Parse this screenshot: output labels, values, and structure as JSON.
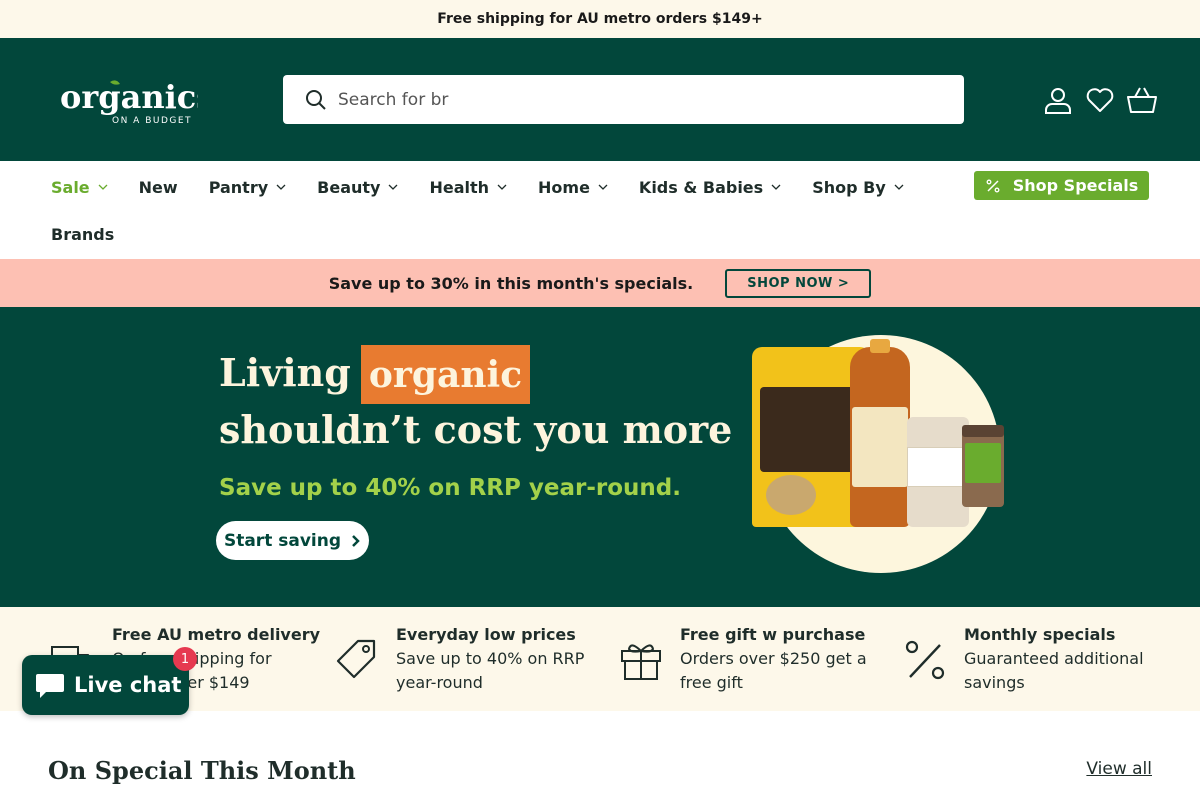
{
  "announcement": "Free shipping for AU metro orders $149+",
  "brand": {
    "logo_main": "organics",
    "logo_sub": "ON A BUDGET"
  },
  "search": {
    "placeholder": "Search for br"
  },
  "nav": {
    "items": [
      {
        "label": "Sale",
        "has_dropdown": true,
        "highlight": true
      },
      {
        "label": "New",
        "has_dropdown": false
      },
      {
        "label": "Pantry",
        "has_dropdown": true
      },
      {
        "label": "Beauty",
        "has_dropdown": true
      },
      {
        "label": "Health",
        "has_dropdown": true
      },
      {
        "label": "Home",
        "has_dropdown": true
      },
      {
        "label": "Kids & Babies",
        "has_dropdown": true
      },
      {
        "label": "Shop By",
        "has_dropdown": true
      }
    ],
    "brands": "Brands",
    "specials_button": "Shop Specials"
  },
  "promo": {
    "text": "Save up to 30% in this month's specials.",
    "button": "SHOP NOW >"
  },
  "hero": {
    "word1": "Living",
    "word2": "organic",
    "line2": "shouldn’t cost you more",
    "line3": "Save up to 40% on RRP year-round.",
    "cta": "Start saving"
  },
  "usps": [
    {
      "title": "Free AU metro delivery",
      "desc1": "On free shipping for",
      "desc2": "orders over $149",
      "icon": "truck-icon"
    },
    {
      "title": "Everyday low prices",
      "desc1": "Save up to 40% on RRP",
      "desc2": "year-round",
      "icon": "price-tag-icon"
    },
    {
      "title": "Free gift w purchase",
      "desc1": "Orders over $250 get a",
      "desc2": "free gift",
      "icon": "gift-icon"
    },
    {
      "title": "Monthly specials",
      "desc1": "Guaranteed additional",
      "desc2": "savings",
      "icon": "percent-icon"
    }
  ],
  "section": {
    "title": "On Special This Month",
    "view_all": "View all"
  },
  "chat": {
    "label": "Live chat",
    "badge": "1"
  },
  "colors": {
    "brand_green": "#02473b",
    "accent_green": "#6aac2e",
    "promo_pink": "#fdc0b3",
    "cream": "#fdf8ea",
    "orange": "#e87b30"
  }
}
